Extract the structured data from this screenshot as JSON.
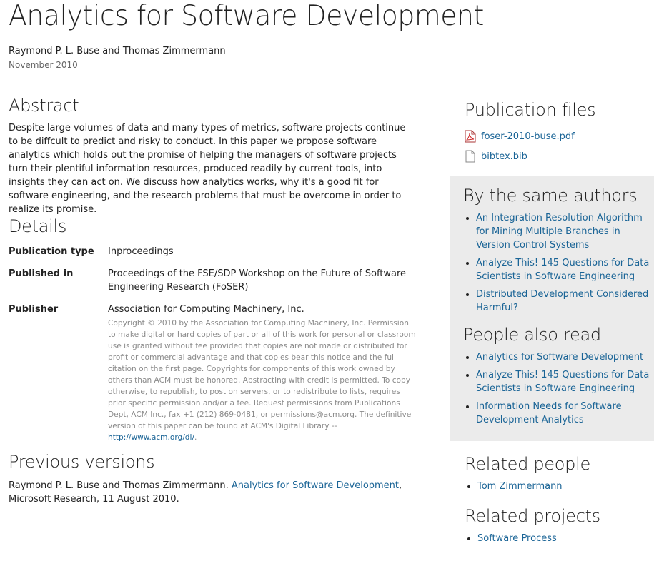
{
  "title": "Analytics for Software Development",
  "authors": "Raymond P. L. Buse and Thomas Zimmermann",
  "date": "November 2010",
  "abstract": {
    "heading": "Abstract",
    "text": "Despite large volumes of data and many types of metrics, software projects continue to be diffcult to predict and risky to conduct. In this paper we propose software analytics which holds out the promise of helping the managers of software projects turn their plentiful information resources, produced readily by current tools, into insights they can act on. We discuss how analytics works, why it's a good fit for software engineering, and the research problems that must be overcome in order to realize its promise."
  },
  "details": {
    "heading": "Details",
    "rows": [
      {
        "key": "Publication type",
        "value": "Inproceedings"
      },
      {
        "key": "Published in",
        "value": "Proceedings of the FSE/SDP Workshop on the Future of Software Engineering Research (FoSER)"
      },
      {
        "key": "Publisher",
        "value": "Association for Computing Machinery, Inc."
      }
    ],
    "copyright": "Copyright © 2010 by the Association for Computing Machinery, Inc. Permission to make digital or hard copies of part or all of this work for personal or classroom use is granted without fee provided that copies are not made or distributed for profit or commercial advantage and that copies bear this notice and the full citation on the first page. Copyrights for components of this work owned by others than ACM must be honored. Abstracting with credit is permitted. To copy otherwise, to republish, to post on servers, or to redistribute to lists, requires prior specific permission and/or a fee. Request permissions from Publications Dept, ACM Inc., fax +1 (212) 869-0481, or permissions@acm.org. The definitive version of this paper can be found at ACM's Digital Library --",
    "copyright_link": "http://www.acm.org/dl/",
    "copyright_end": "."
  },
  "previous": {
    "heading": "Previous versions",
    "prefix": "Raymond P. L. Buse and Thomas Zimmermann. ",
    "link": "Analytics for Software Development",
    "suffix": ", Microsoft Research, 11 August 2010."
  },
  "sidebar": {
    "files_heading": "Publication files",
    "files": [
      {
        "name": "foser-2010-buse.pdf",
        "icon": "pdf-file-icon"
      },
      {
        "name": "bibtex.bib",
        "icon": "document-file-icon"
      }
    ],
    "same_authors_heading": "By the same authors",
    "same_authors": [
      "An Integration Resolution Algorithm for Mining Multiple Branches in Version Control Systems",
      "Analyze This! 145 Questions for Data Scientists in Software Engineering",
      "Distributed Development Considered Harmful?"
    ],
    "also_read_heading": "People also read",
    "also_read": [
      "Analytics for Software Development",
      "Analyze This! 145 Questions for Data Scientists in Software Engineering",
      "Information Needs for Software Development Analytics"
    ],
    "related_people_heading": "Related people",
    "related_people": [
      "Tom Zimmermann"
    ],
    "related_projects_heading": "Related projects",
    "related_projects": [
      "Software Process"
    ]
  }
}
